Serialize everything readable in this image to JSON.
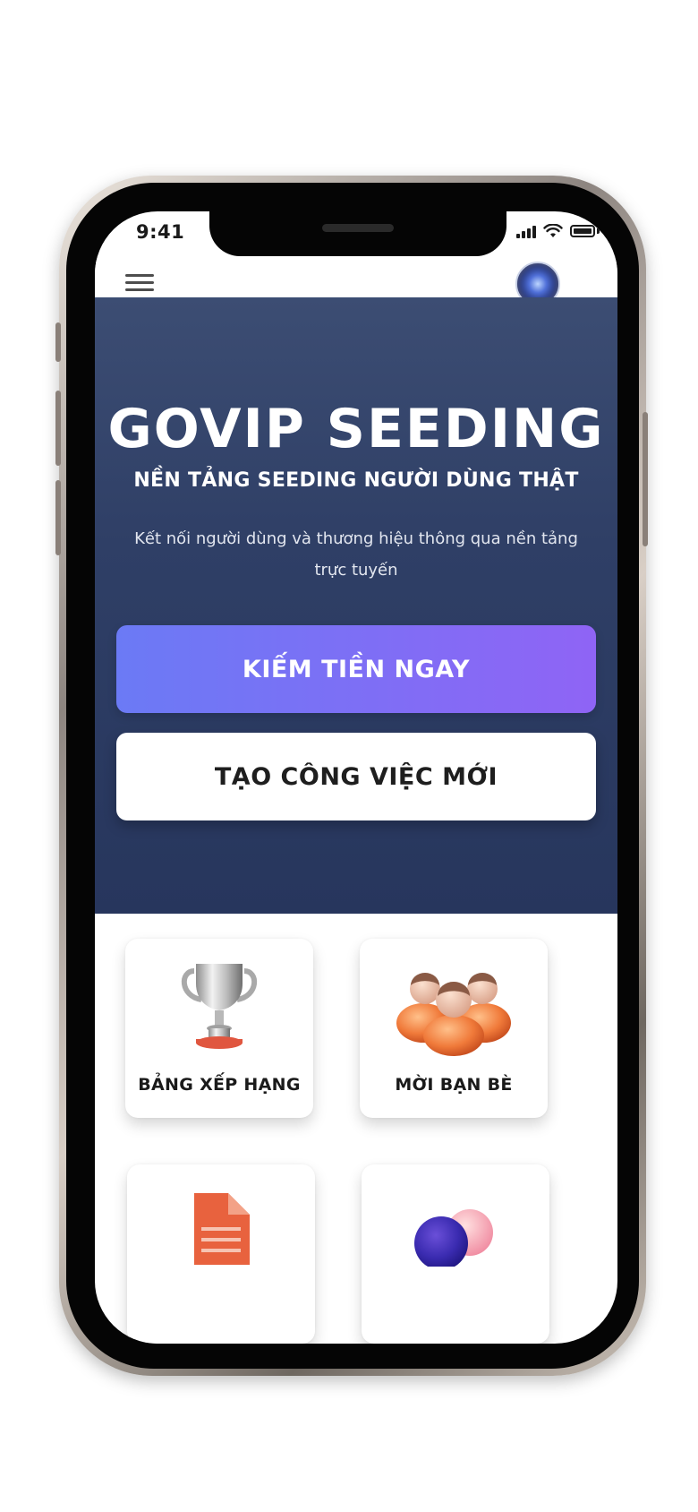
{
  "status_bar": {
    "time": "9:41"
  },
  "hero": {
    "title": "GOVIP SEEDING",
    "subtitle": "NỀN TẢNG SEEDING NGƯỜI DÙNG THẬT",
    "description": "Kết nối người dùng và thương hiệu thông qua nền tảng trực tuyến"
  },
  "actions": {
    "earn_label": "KIẾM TIỀN NGAY",
    "create_label": "TẠO CÔNG VIỆC MỚI"
  },
  "features": [
    {
      "label": "BẢNG XẾP HẠNG",
      "icon": "trophy-icon"
    },
    {
      "label": "MỜI BẠN BÈ",
      "icon": "friends-icon"
    },
    {
      "label": "",
      "icon": "document-icon"
    },
    {
      "label": "",
      "icon": "bubbles-icon"
    }
  ],
  "colors": {
    "hero_bg": "#2f3f66",
    "primary_gradient_start": "#6b7af5",
    "primary_gradient_end": "#8f64f5"
  }
}
